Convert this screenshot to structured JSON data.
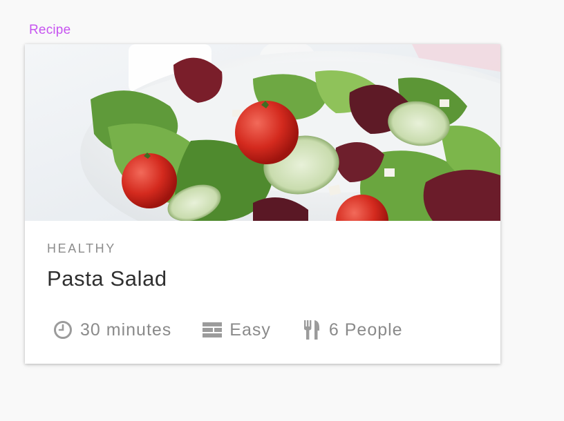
{
  "frame": {
    "label": "Recipe",
    "label_color": "#c654f0"
  },
  "card": {
    "image": {
      "subject": "salad-bowl-photo"
    },
    "category": "HEALTHY",
    "title": "Pasta Salad",
    "meta": [
      {
        "icon": "clock-icon",
        "text": "30 minutes"
      },
      {
        "icon": "difficulty-bars-icon",
        "text": "Easy"
      },
      {
        "icon": "fork-knife-icon",
        "text": "6 People"
      }
    ]
  },
  "colors": {
    "background": "#f9f9f9",
    "card": "#ffffff",
    "category_text": "#8c8c8c",
    "title_text": "#2f2f2f",
    "meta_text": "#8a8a8a",
    "icon": "#9b9b9b"
  }
}
